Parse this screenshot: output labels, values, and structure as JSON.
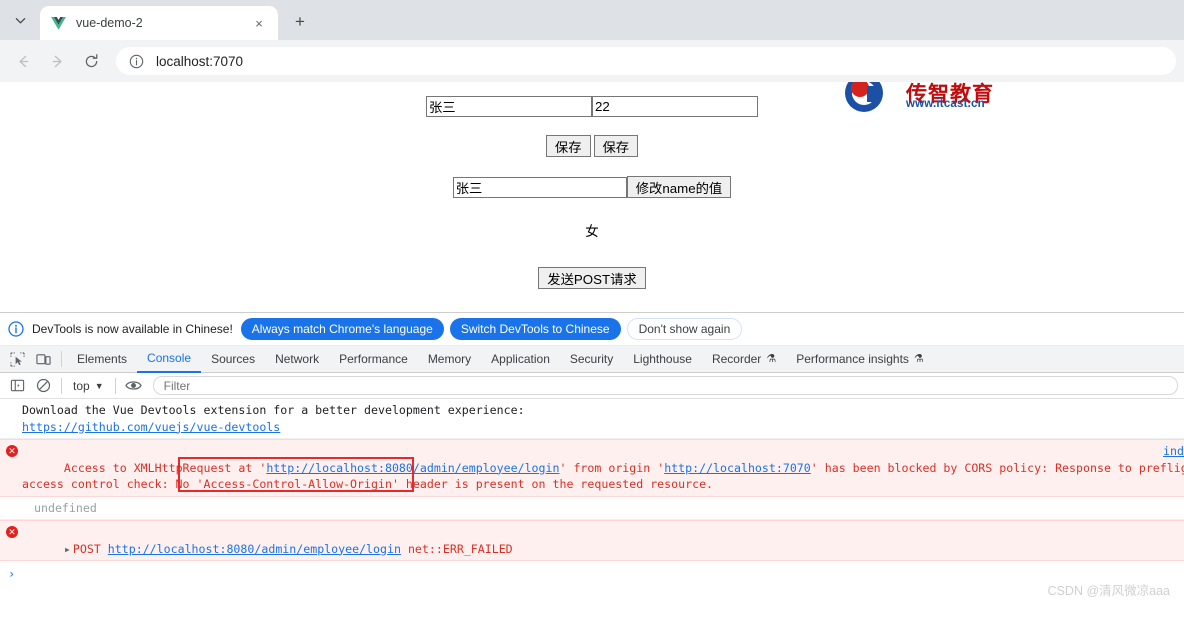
{
  "browser": {
    "tab": {
      "title": "vue-demo-2",
      "favicon": "vue-logo-icon",
      "close_label": "×"
    },
    "new_tab_label": "+",
    "tab_list_label": "⌄",
    "nav": {
      "back": "←",
      "forward": "→",
      "reload": "⟳"
    },
    "omnibox": {
      "info_icon": "ⓘ",
      "url": "localhost:7070"
    }
  },
  "page": {
    "logo": {
      "cn": "传智教育",
      "url": "www.itcast.cn"
    },
    "name_input": "张三",
    "age_input": "22",
    "save_button_1": "保存",
    "save_button_2": "保存",
    "name_input_2": "张三",
    "modify_name_button": "修改name的值",
    "gender_text": "女",
    "post_button": "发送POST请求"
  },
  "devtools": {
    "banner": {
      "icon": "info-icon",
      "text": "DevTools is now available in Chinese!",
      "btn_always": "Always match Chrome's language",
      "btn_switch": "Switch DevTools to Chinese",
      "btn_dismiss": "Don't show again"
    },
    "tabs": [
      {
        "label": "Elements",
        "active": false
      },
      {
        "label": "Console",
        "active": true
      },
      {
        "label": "Sources",
        "active": false
      },
      {
        "label": "Network",
        "active": false
      },
      {
        "label": "Performance",
        "active": false
      },
      {
        "label": "Memory",
        "active": false
      },
      {
        "label": "Application",
        "active": false
      },
      {
        "label": "Security",
        "active": false
      },
      {
        "label": "Lighthouse",
        "active": false
      },
      {
        "label": "Recorder",
        "active": false,
        "flask": "⚗"
      },
      {
        "label": "Performance insights",
        "active": false,
        "flask": "⚗"
      }
    ],
    "inspect_icon": "inspect-element-icon",
    "device_icon": "device-toolbar-icon",
    "console_toolbar": {
      "sidebar_icon": "console-sidebar-icon",
      "clear_icon": "clear-console-icon",
      "context": "top",
      "context_caret": "▼",
      "eye_icon": "live-expression-icon",
      "filter_placeholder": "Filter"
    },
    "messages": [
      {
        "type": "info",
        "line1": "Download the Vue Devtools extension for a better development experience:",
        "link": "https://github.com/vuejs/vue-devtools"
      },
      {
        "type": "error",
        "seg1": "Access to XMLHttpRequest at '",
        "link1": "http://localhost:8080/admin/employee/login",
        "seg2": "' from origin '",
        "link2": "http://localhost:7070",
        "seg3": "' has been blocked by CORS policy: Response to preflight r",
        "line2": "access control check: No 'Access-Control-Allow-Origin' header is present on the requested resource.",
        "source": "ind"
      },
      {
        "type": "undefined",
        "text": "undefined"
      },
      {
        "type": "error",
        "disclosure": "▸",
        "method": "POST",
        "link1": "http://localhost:8080/admin/employee/login",
        "tail": "net::ERR_FAILED"
      }
    ],
    "prompt_caret": "›"
  },
  "watermark": "CSDN @清风微凉aaa",
  "colors": {
    "accent": "#1a73e8",
    "error": "#d93025",
    "annotation": "#e8282b",
    "tabstrip": "#dee1e6",
    "toolbar": "#f1f3f4"
  }
}
